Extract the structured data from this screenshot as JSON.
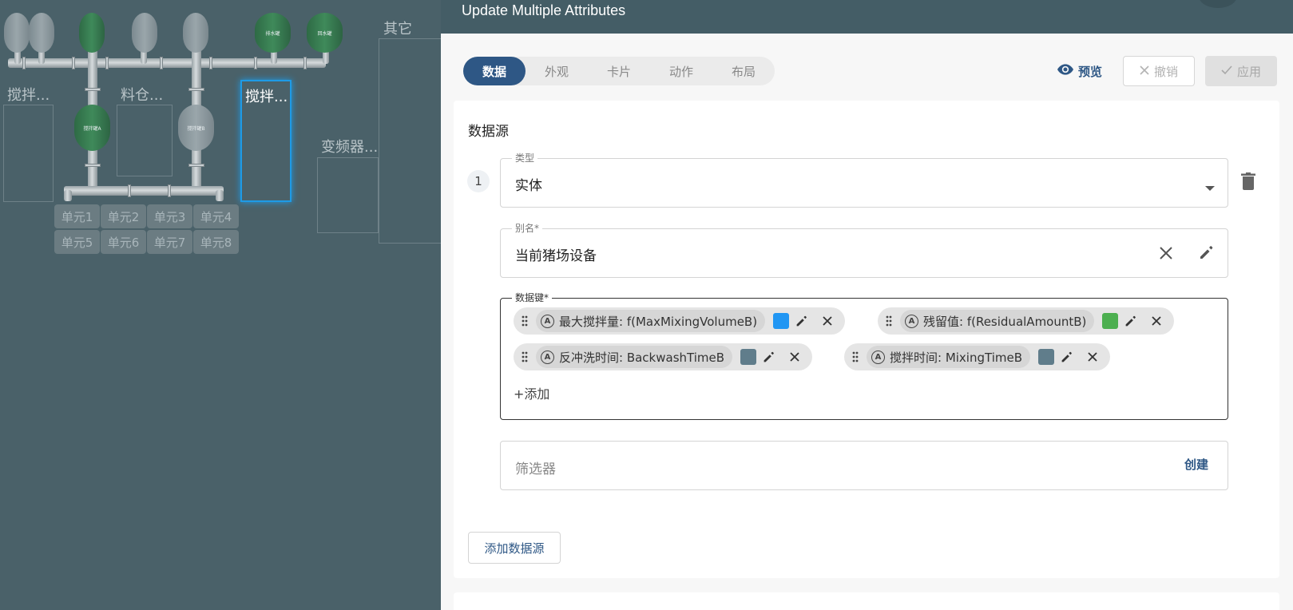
{
  "dashboard": {
    "tank_labels": [
      "搅拌罐A",
      "搅拌罐B",
      "排水罐",
      "回水罐"
    ],
    "group_labels": [
      "搅拌...",
      "料仓...",
      "搅拌...",
      "变频器...",
      "其它"
    ],
    "units": [
      "单元1",
      "单元2",
      "单元3",
      "单元4",
      "单元5",
      "单元6",
      "单元7",
      "单元8"
    ]
  },
  "dialog": {
    "title": "Update Multiple Attributes",
    "tabs": [
      {
        "label": "数据",
        "active": true
      },
      {
        "label": "外观",
        "active": false
      },
      {
        "label": "卡片",
        "active": false
      },
      {
        "label": "动作",
        "active": false
      },
      {
        "label": "布局",
        "active": false
      }
    ],
    "preview_label": "预览",
    "undo_label": "撤销",
    "apply_label": "应用"
  },
  "datasources": {
    "section_title": "数据源",
    "index": "1",
    "type_label": "类型",
    "type_value": "实体",
    "alias_label": "别名*",
    "alias_value": "当前猪场设备",
    "keys_label": "数据键*",
    "keys": [
      {
        "text": "最大搅拌量: f(MaxMixingVolumeB)",
        "color": "#2196f3"
      },
      {
        "text": "残留值: f(ResidualAmountB)",
        "color": "#4caf50"
      },
      {
        "text": "反冲洗时间: BackwashTimeB",
        "color": "#607d8b"
      },
      {
        "text": "搅拌时间: MixingTimeB",
        "color": "#607d8b"
      }
    ],
    "add_key_label": "+添加",
    "filter_placeholder": "筛选器",
    "filter_create_label": "创建",
    "add_datasource_label": "添加数据源"
  },
  "colors": {
    "accent": "#2e5785",
    "header": "#445d66",
    "backdrop": "#4a6169"
  }
}
